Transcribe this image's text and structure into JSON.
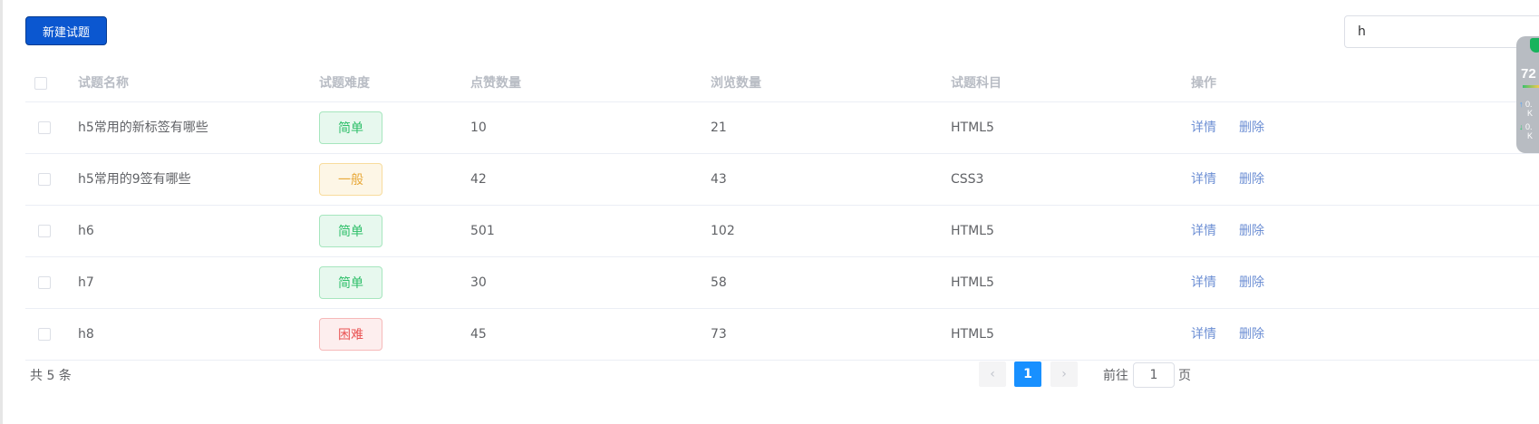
{
  "toolbar": {
    "new_button_label": "新建试题",
    "search_value": "h"
  },
  "table": {
    "headers": [
      "试题名称",
      "试题难度",
      "点赞数量",
      "浏览数量",
      "试题科目",
      "操作"
    ],
    "rows": [
      {
        "name": "h5常用的新标签有哪些",
        "difficulty": "简单",
        "level": "easy",
        "likes": "10",
        "views": "21",
        "subject": "HTML5",
        "detail": "详情",
        "delete": "删除"
      },
      {
        "name": "h5常用的9签有哪些",
        "difficulty": "一般",
        "level": "normal",
        "likes": "42",
        "views": "43",
        "subject": "CSS3",
        "detail": "详情",
        "delete": "删除"
      },
      {
        "name": "h6",
        "difficulty": "简单",
        "level": "easy",
        "likes": "501",
        "views": "102",
        "subject": "HTML5",
        "detail": "详情",
        "delete": "删除"
      },
      {
        "name": "h7",
        "difficulty": "简单",
        "level": "easy",
        "likes": "30",
        "views": "58",
        "subject": "HTML5",
        "detail": "详情",
        "delete": "删除"
      },
      {
        "name": "h8",
        "difficulty": "困难",
        "level": "hard",
        "likes": "45",
        "views": "73",
        "subject": "HTML5",
        "detail": "详情",
        "delete": "删除"
      }
    ]
  },
  "pagination": {
    "total_text": "共 5 条",
    "prev_icon": "‹",
    "current_page": "1",
    "next_icon": "›",
    "goto_label": "前往",
    "goto_value": "1",
    "goto_suffix": "页"
  },
  "widget": {
    "score": "72",
    "upload_value": "0.",
    "download_value": "0.",
    "unit": "K"
  },
  "colors": {
    "primary": "#0b57d0",
    "link": "#6d8fd4",
    "easy": "#2fbf6a",
    "normal": "#e8a93a",
    "hard": "#e95454",
    "page_active": "#1890ff"
  }
}
